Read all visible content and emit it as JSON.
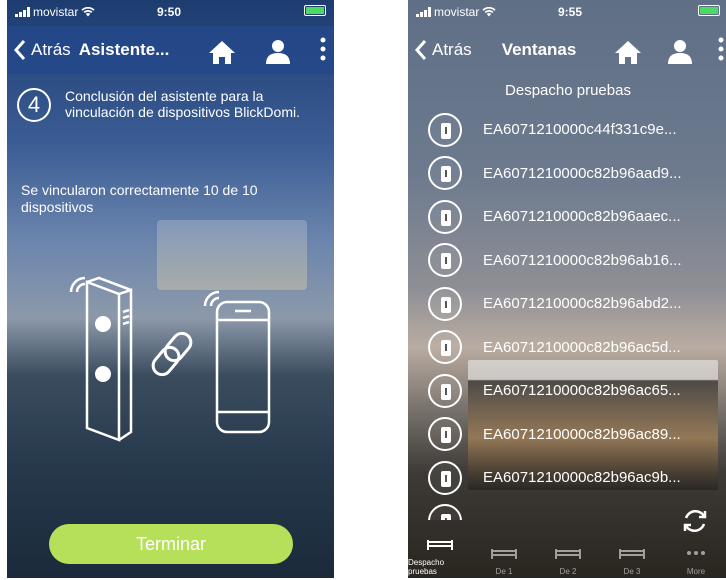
{
  "left": {
    "status": {
      "carrier": "movistar",
      "time": "9:50"
    },
    "nav": {
      "back_label": "Atrás",
      "title": "Asistente...",
      "icons": [
        "home-icon",
        "user-icon",
        "kebab-menu-icon"
      ]
    },
    "step": {
      "number": "4",
      "text": "Conclusión del asistente para la vinculación de dispositivos BlickDomi."
    },
    "result_text": "Se vincularon correctamente 10 de 10 dispositivos",
    "finish_label": "Terminar"
  },
  "right": {
    "status": {
      "carrier": "movistar",
      "time": "9:55"
    },
    "nav": {
      "back_label": "Atrás",
      "title": "Ventanas",
      "icons": [
        "home-icon",
        "user-icon",
        "kebab-menu-icon"
      ]
    },
    "section_title": "Despacho pruebas",
    "devices": [
      "EA6071210000c44f331c9e...",
      "EA6071210000c82b96aad9...",
      "EA6071210000c82b96aaec...",
      "EA6071210000c82b96ab16...",
      "EA6071210000c82b96abd2...",
      "EA6071210000c82b96ac5d...",
      "EA6071210000c82b96ac65...",
      "EA6071210000c82b96ac89...",
      "EA6071210000c82b96ac9b...",
      ""
    ],
    "tabs": [
      {
        "label": "Despacho pruebas",
        "active": true
      },
      {
        "label": "De 1"
      },
      {
        "label": "De 2"
      },
      {
        "label": "De 3"
      },
      {
        "label": "More"
      }
    ]
  },
  "colors": {
    "accent_green": "#b6e05a",
    "nav_blue": "#24488a",
    "battery_green": "#4cd964"
  }
}
